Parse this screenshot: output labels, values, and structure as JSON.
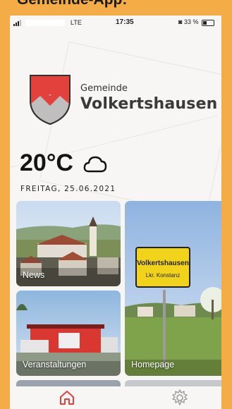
{
  "caption": "Gemeinde-App:",
  "status_bar": {
    "carrier": "LTE",
    "time": "17:35",
    "battery": "33 %"
  },
  "header": {
    "label": "Gemeinde",
    "name": "Volkertshausen"
  },
  "weather": {
    "temperature": "20°C",
    "date": "FREITAG, 25.06.2021",
    "icon": "cloud-icon"
  },
  "tiles": {
    "news": {
      "label": "News"
    },
    "events": {
      "label": "Veranstaltungen"
    },
    "homepage": {
      "label": "Homepage",
      "sign_name": "Volkertshausen",
      "sign_sub": "Lkr. Konstanz"
    }
  },
  "tabbar": {
    "items": [
      {
        "icon": "home-icon",
        "active": true
      },
      {
        "icon": "gear-icon",
        "active": false
      }
    ]
  },
  "colors": {
    "accent": "#e3423c",
    "background": "#f4ad46"
  }
}
